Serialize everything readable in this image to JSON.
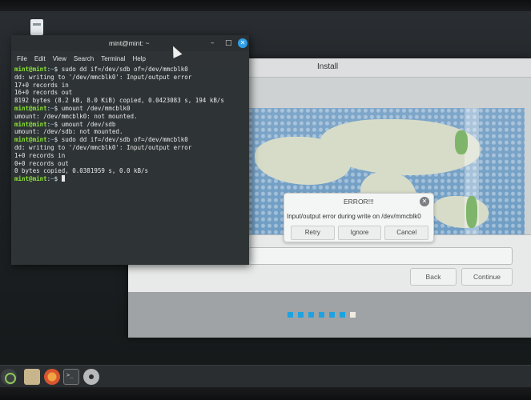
{
  "terminal": {
    "title": "mint@mint: ~",
    "menu": [
      "File",
      "Edit",
      "View",
      "Search",
      "Terminal",
      "Help"
    ],
    "lines": [
      {
        "prompt": "mint@mint",
        "path": "~",
        "text": "$ sudo dd if=/dev/sdb of=/dev/mmcblk0"
      },
      {
        "text": "dd: writing to '/dev/mmcblk0': Input/output error"
      },
      {
        "text": "17+0 records in"
      },
      {
        "text": "16+0 records out"
      },
      {
        "text": "8192 bytes (8.2 kB, 8.0 KiB) copied, 0.0423083 s, 194 kB/s"
      },
      {
        "prompt": "mint@mint",
        "path": "~",
        "text": "$ umount /dev/mmcblk0"
      },
      {
        "text": "umount: /dev/mmcblk0: not mounted."
      },
      {
        "prompt": "mint@mint",
        "path": "~",
        "text": "$ umount /dev/sdb"
      },
      {
        "text": "umount: /dev/sdb: not mounted."
      },
      {
        "prompt": "mint@mint",
        "path": "~",
        "text": "$ sudo dd if=/dev/sdb of=/dev/mmcblk0"
      },
      {
        "text": "dd: writing to '/dev/mmcblk0': Input/output error"
      },
      {
        "text": "1+0 records in"
      },
      {
        "text": "0+0 records out"
      },
      {
        "text": "0 bytes copied, 0.0381959 s, 0.0 kB/s"
      },
      {
        "prompt": "mint@mint",
        "path": "~",
        "text": "$ ",
        "cursor": true
      }
    ]
  },
  "installer": {
    "title": "Install",
    "back_label": "Back",
    "continue_label": "Continue",
    "progress": {
      "total": 7,
      "current": 7
    }
  },
  "error_dialog": {
    "title": "ERROR!!!",
    "message": "Input/output error during write on /dev/mmcblk0",
    "retry_label": "Retry",
    "ignore_label": "Ignore",
    "cancel_label": "Cancel"
  },
  "taskbar": {
    "icons": [
      "mint-menu-icon",
      "files-icon",
      "firefox-icon",
      "terminal-icon",
      "disc-icon"
    ]
  },
  "colors": {
    "prompt": "#8ae234",
    "path": "#729fcf",
    "accent": "#1ea3e0",
    "terminal_bg": "#2e3436"
  }
}
